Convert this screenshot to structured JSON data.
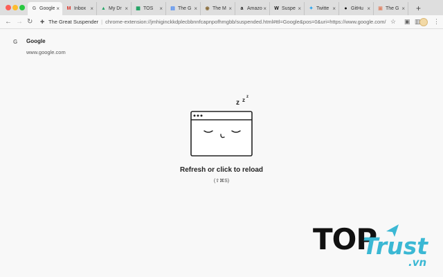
{
  "tabs": [
    {
      "label": "Google",
      "favicon": "google-favicon",
      "icon_char": "G",
      "icon_color": "#777777",
      "active": true
    },
    {
      "label": "Inbox",
      "favicon": "gmail-favicon",
      "icon_char": "M",
      "icon_color": "#d93025",
      "active": false
    },
    {
      "label": "My Dr",
      "favicon": "drive-favicon",
      "icon_char": "▲",
      "icon_color": "#1fa463",
      "active": false
    },
    {
      "label": "TOS",
      "favicon": "sheets-favicon",
      "icon_char": "▦",
      "icon_color": "#0f9d58",
      "active": false
    },
    {
      "label": "The G",
      "favicon": "docs-favicon",
      "icon_char": "▤",
      "icon_color": "#4285f4",
      "active": false
    },
    {
      "label": "The M",
      "favicon": "medium-favicon",
      "icon_char": "◉",
      "icon_color": "#8a6d3b",
      "active": false
    },
    {
      "label": "Amazo",
      "favicon": "amazon-favicon",
      "icon_char": "a",
      "icon_color": "#111111",
      "active": false
    },
    {
      "label": "Suspe",
      "favicon": "wikipedia-favicon",
      "icon_char": "W",
      "icon_color": "#111111",
      "active": false
    },
    {
      "label": "Twitte",
      "favicon": "twitter-favicon",
      "icon_char": "✦",
      "icon_color": "#1da1f2",
      "active": false
    },
    {
      "label": "GitHu",
      "favicon": "github-favicon",
      "icon_char": "●",
      "icon_color": "#111111",
      "active": false
    },
    {
      "label": "The G",
      "favicon": "suspender-favicon",
      "icon_char": "▣",
      "icon_color": "#e08a6d",
      "active": false
    }
  ],
  "toolbar": {
    "extension_name": "The Great Suspender",
    "url": "chrome-extension://jmhiginckkdplecbbnnfcapnpofhmgbb/suspended.html#ttl=Google&pos=0&uri=https://www.google.com/"
  },
  "page": {
    "site_title": "Google",
    "site_url": "www.google.com",
    "zzz": [
      "z",
      "z",
      "z"
    ],
    "reload_text": "Refresh or click to reload",
    "shortcut": "(⇧⌘S)"
  },
  "watermark": {
    "brand_top": "TOP",
    "brand_trust": "Trust",
    "brand_tld": ".vn"
  },
  "colors": {
    "accent": "#3bb8d4",
    "tabstrip": "#dedede",
    "page_bg": "#f8f8f8"
  }
}
